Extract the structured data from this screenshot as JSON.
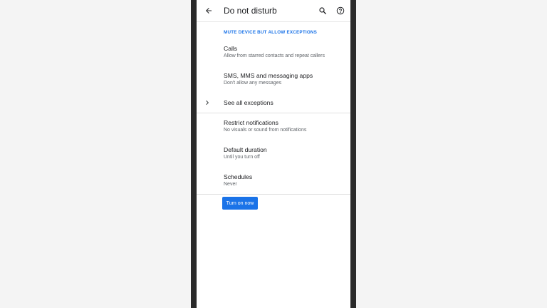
{
  "app_bar": {
    "title": "Do not disturb",
    "back_icon": "arrow-back-icon",
    "search_icon": "search-icon",
    "help_icon": "help-icon"
  },
  "section_header": "MUTE DEVICE BUT ALLOW EXCEPTIONS",
  "exceptions": [
    {
      "title": "Calls",
      "summary": "Allow from starred contacts and repeat callers"
    },
    {
      "title": "SMS, MMS and messaging apps",
      "summary": "Don't allow any messages"
    }
  ],
  "see_all": {
    "label": "See all exceptions",
    "icon": "chevron-right-icon"
  },
  "settings": [
    {
      "title": "Restrict notifications",
      "summary": "No visuals or sound from notifications"
    },
    {
      "title": "Default duration",
      "summary": "Until you turn off"
    },
    {
      "title": "Schedules",
      "summary": "Never"
    }
  ],
  "turn_on_button": "Turn on now",
  "colors": {
    "accent": "#1a73e8",
    "bezel": "#2a2a2a",
    "background": "#f4f4f4"
  }
}
